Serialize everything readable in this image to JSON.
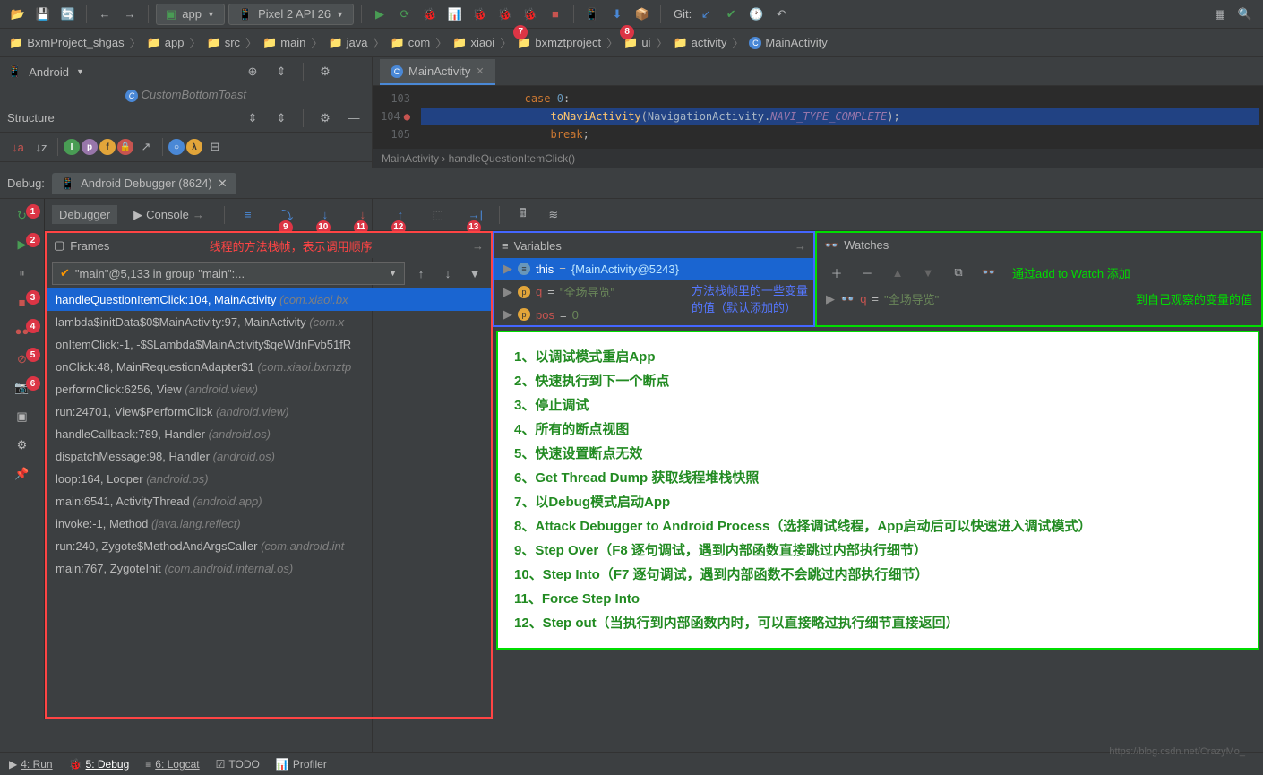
{
  "toolbar": {
    "run_config": "app",
    "device": "Pixel 2 API 26",
    "git_label": "Git:"
  },
  "breadcrumbs": [
    "BxmProject_shgas",
    "app",
    "src",
    "main",
    "java",
    "com",
    "xiaoi",
    "bxmztproject",
    "ui",
    "activity",
    "MainActivity"
  ],
  "crumb_badges": {
    "7": "7",
    "8": "8"
  },
  "left": {
    "android_label": "Android",
    "structure_label": "Structure",
    "custom_toast": "CustomBottomToast"
  },
  "editor": {
    "tab_label": "MainActivity",
    "gutter": [
      "103",
      "104",
      "105"
    ],
    "code_line1": "                case 0:",
    "code_line2": "                    toNaviActivity(NavigationActivity.NAVI_TYPE_COMPLETE);",
    "code_line3": "                    break;",
    "breadcrumb": "MainActivity › handleQuestionItemClick()"
  },
  "debug": {
    "label": "Debug:",
    "session": "Android Debugger (8624)",
    "tabs": {
      "debugger": "Debugger",
      "console": "Console"
    },
    "step_badges": [
      "9",
      "10",
      "11",
      "12",
      "13"
    ],
    "left_badges": [
      "1",
      "2",
      "3",
      "4",
      "5",
      "6"
    ]
  },
  "frames": {
    "title": "Frames",
    "annotation": "线程的方法栈帧，表示调用顺序",
    "thread_selector": "\"main\"@5,133 in group \"main\":...",
    "list": [
      {
        "label": "handleQuestionItemClick:104, MainActivity ",
        "pkg": "(com.xiaoi.bx"
      },
      {
        "label": "lambda$initData$0$MainActivity:97, MainActivity ",
        "pkg": "(com.x"
      },
      {
        "label": "onItemClick:-1, -$$Lambda$MainActivity$qeWdnFvb51fR",
        "pkg": ""
      },
      {
        "label": "onClick:48, MainRequestionAdapter$1 ",
        "pkg": "(com.xiaoi.bxmztp"
      },
      {
        "label": "performClick:6256, View ",
        "pkg": "(android.view)"
      },
      {
        "label": "run:24701, View$PerformClick ",
        "pkg": "(android.view)"
      },
      {
        "label": "handleCallback:789, Handler ",
        "pkg": "(android.os)"
      },
      {
        "label": "dispatchMessage:98, Handler ",
        "pkg": "(android.os)"
      },
      {
        "label": "loop:164, Looper ",
        "pkg": "(android.os)"
      },
      {
        "label": "main:6541, ActivityThread ",
        "pkg": "(android.app)"
      },
      {
        "label": "invoke:-1, Method ",
        "pkg": "(java.lang.reflect)"
      },
      {
        "label": "run:240, Zygote$MethodAndArgsCaller ",
        "pkg": "(com.android.int"
      },
      {
        "label": "main:767, ZygoteInit ",
        "pkg": "(com.android.internal.os)"
      }
    ]
  },
  "variables": {
    "title": "Variables",
    "annotation1": "方法栈帧里的一些变量",
    "annotation2": "的值（默认添加的）",
    "rows": [
      {
        "icon": "≡",
        "name": "this",
        "eq": " = ",
        "val": "{MainActivity@5243}"
      },
      {
        "icon": "p",
        "name": "q",
        "eq": " = ",
        "val": "\"全场导览\""
      },
      {
        "icon": "p",
        "name": "pos",
        "eq": " = ",
        "val": "0"
      }
    ]
  },
  "watches": {
    "title": "Watches",
    "annotation1": "通过add to Watch 添加",
    "annotation2": "到自己观察的变量的值",
    "row": {
      "name": "q",
      "eq": " = ",
      "val": "\"全场导览\""
    }
  },
  "info_lines": [
    "1、以调试模式重启App",
    "2、快速执行到下一个断点",
    "3、停止调试",
    "4、所有的断点视图",
    "5、快速设置断点无效",
    "6、Get Thread Dump 获取线程堆栈快照",
    "7、以Debug模式启动App",
    "8、Attack Debugger to Android Process（选择调试线程，App启动后可以快速进入调试模式）",
    "9、Step Over（F8 逐句调试，遇到内部函数直接跳过内部执行细节）",
    "10、Step Into（F7 逐句调试，遇到内部函数不会跳过内部执行细节）",
    "11、Force Step Into",
    "12、Step out（当执行到内部函数内时，可以直接略过执行细节直接返回）"
  ],
  "bottom": {
    "run": "4: Run",
    "debug": "5: Debug",
    "logcat": "6: Logcat",
    "todo": "TODO",
    "profiler": "Profiler"
  },
  "watermark": "https://blog.csdn.net/CrazyMo_"
}
